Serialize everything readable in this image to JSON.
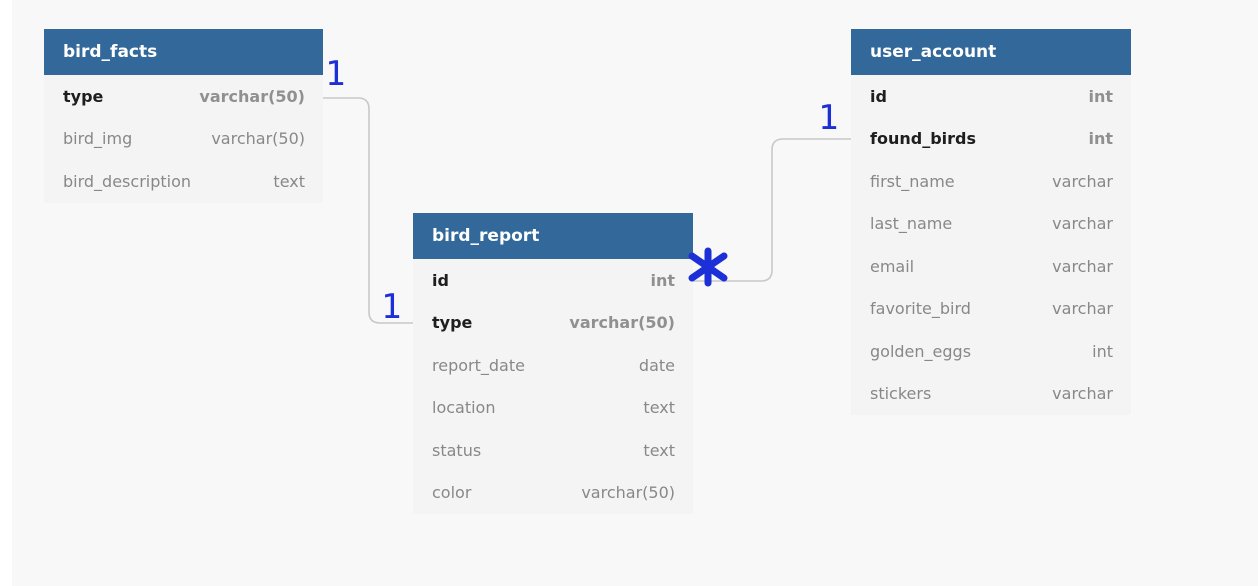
{
  "tables": [
    {
      "id": "bird_facts",
      "title": "bird_facts",
      "rows": [
        {
          "name": "type",
          "type": "varchar(50)",
          "key": true
        },
        {
          "name": "bird_img",
          "type": "varchar(50)",
          "key": false
        },
        {
          "name": "bird_description",
          "type": "text",
          "key": false
        }
      ]
    },
    {
      "id": "bird_report",
      "title": "bird_report",
      "rows": [
        {
          "name": "id",
          "type": "int",
          "key": true
        },
        {
          "name": "type",
          "type": "varchar(50)",
          "key": true
        },
        {
          "name": "report_date",
          "type": "date",
          "key": false
        },
        {
          "name": "location",
          "type": "text",
          "key": false
        },
        {
          "name": "status",
          "type": "text",
          "key": false
        },
        {
          "name": "color",
          "type": "varchar(50)",
          "key": false
        }
      ]
    },
    {
      "id": "user_account",
      "title": "user_account",
      "rows": [
        {
          "name": "id",
          "type": "int",
          "key": true
        },
        {
          "name": "found_birds",
          "type": "int",
          "key": true
        },
        {
          "name": "first_name",
          "type": "varchar",
          "key": false
        },
        {
          "name": "last_name",
          "type": "varchar",
          "key": false
        },
        {
          "name": "email",
          "type": "varchar",
          "key": false
        },
        {
          "name": "favorite_bird",
          "type": "varchar",
          "key": false
        },
        {
          "name": "golden_eggs",
          "type": "int",
          "key": false
        },
        {
          "name": "stickers",
          "type": "varchar",
          "key": false
        }
      ]
    }
  ],
  "relationships": [
    {
      "from": "bird_facts.type",
      "to": "bird_report.type",
      "from_card": "1",
      "to_card": "1"
    },
    {
      "from": "user_account.found_birds",
      "to": "bird_report.id",
      "from_card": "1",
      "to_card": "*"
    }
  ],
  "colors": {
    "header": "#32699a",
    "annotation": "#1d2fd6",
    "connector": "#c8c8c8"
  }
}
